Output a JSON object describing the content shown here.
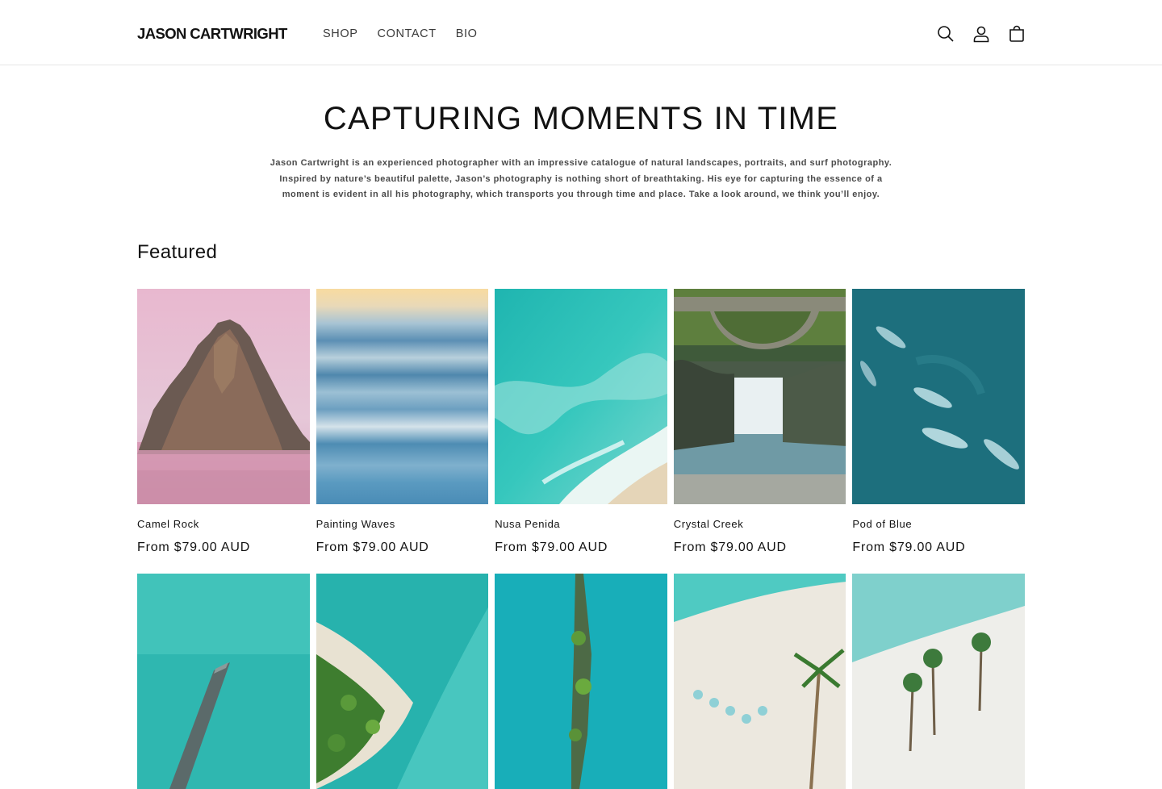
{
  "header": {
    "logo": "JASON CARTWRIGHT",
    "nav": [
      {
        "label": "SHOP"
      },
      {
        "label": "CONTACT"
      },
      {
        "label": "BIO"
      }
    ],
    "icons": [
      "search-icon",
      "account-icon",
      "cart-icon"
    ]
  },
  "hero": {
    "title": "CAPTURING MOMENTS IN TIME",
    "line1": "Jason Cartwright is an experienced photographer with an impressive catalogue of natural landscapes, portraits, and surf photography.",
    "line2": "Inspired by nature’s beautiful palette, Jason’s photography is nothing short of breathtaking. His eye for capturing the essence of a",
    "line3": "moment is evident in all his photography, which transports you through time and place. Take a look around, we think you’ll enjoy."
  },
  "featured": {
    "heading": "Featured",
    "products": [
      {
        "title": "Camel Rock",
        "price": "From $79.00 AUD"
      },
      {
        "title": "Painting Waves",
        "price": "From $79.00 AUD"
      },
      {
        "title": "Nusa Penida",
        "price": "From $79.00 AUD"
      },
      {
        "title": "Crystal Creek",
        "price": "From $79.00 AUD"
      },
      {
        "title": "Pod of Blue",
        "price": "From $79.00 AUD"
      }
    ]
  },
  "colors": {
    "text": "#121212",
    "nav_text": "#3a3a3a",
    "border": "#e6e6e6"
  }
}
